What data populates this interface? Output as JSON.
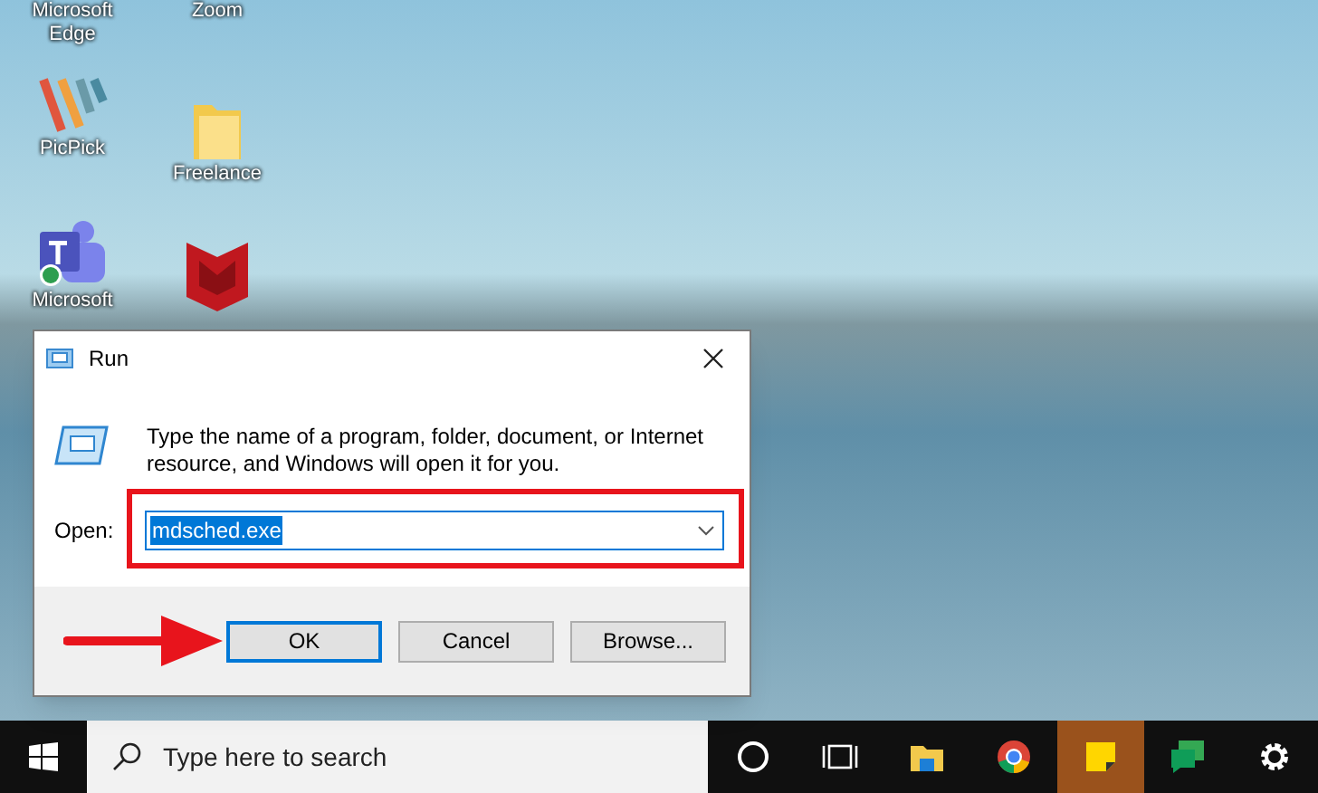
{
  "desktop_icons": [
    {
      "kind": "edge",
      "label": "Microsoft Edge"
    },
    {
      "kind": "zoom",
      "label": "Zoom"
    },
    {
      "kind": "picpick",
      "label": "PicPick"
    },
    {
      "kind": "folder",
      "label": "Freelance"
    },
    {
      "kind": "teams",
      "label": "Microsoft"
    },
    {
      "kind": "mcafee"
    }
  ],
  "dialog": {
    "title": "Run",
    "message": "Type the name of a program, folder, document, or Internet resource, and Windows will open it for you.",
    "open_label": "Open:",
    "open_value": "mdsched.exe",
    "value_selected": true,
    "buttons": [
      {
        "label": "OK",
        "selected": true
      },
      {
        "label": "Cancel",
        "selected": false
      },
      {
        "label": "Browse...",
        "selected": false
      }
    ]
  },
  "taskbar": {
    "search_placeholder": "Type here to search",
    "apps": [
      {
        "kind": "cortana",
        "selected": false
      },
      {
        "kind": "taskview",
        "selected": false
      },
      {
        "kind": "explorer",
        "selected": false
      },
      {
        "kind": "chrome",
        "selected": false
      },
      {
        "kind": "sticky",
        "selected": true
      },
      {
        "kind": "chat",
        "selected": false
      },
      {
        "kind": "settings",
        "selected": false
      }
    ]
  }
}
